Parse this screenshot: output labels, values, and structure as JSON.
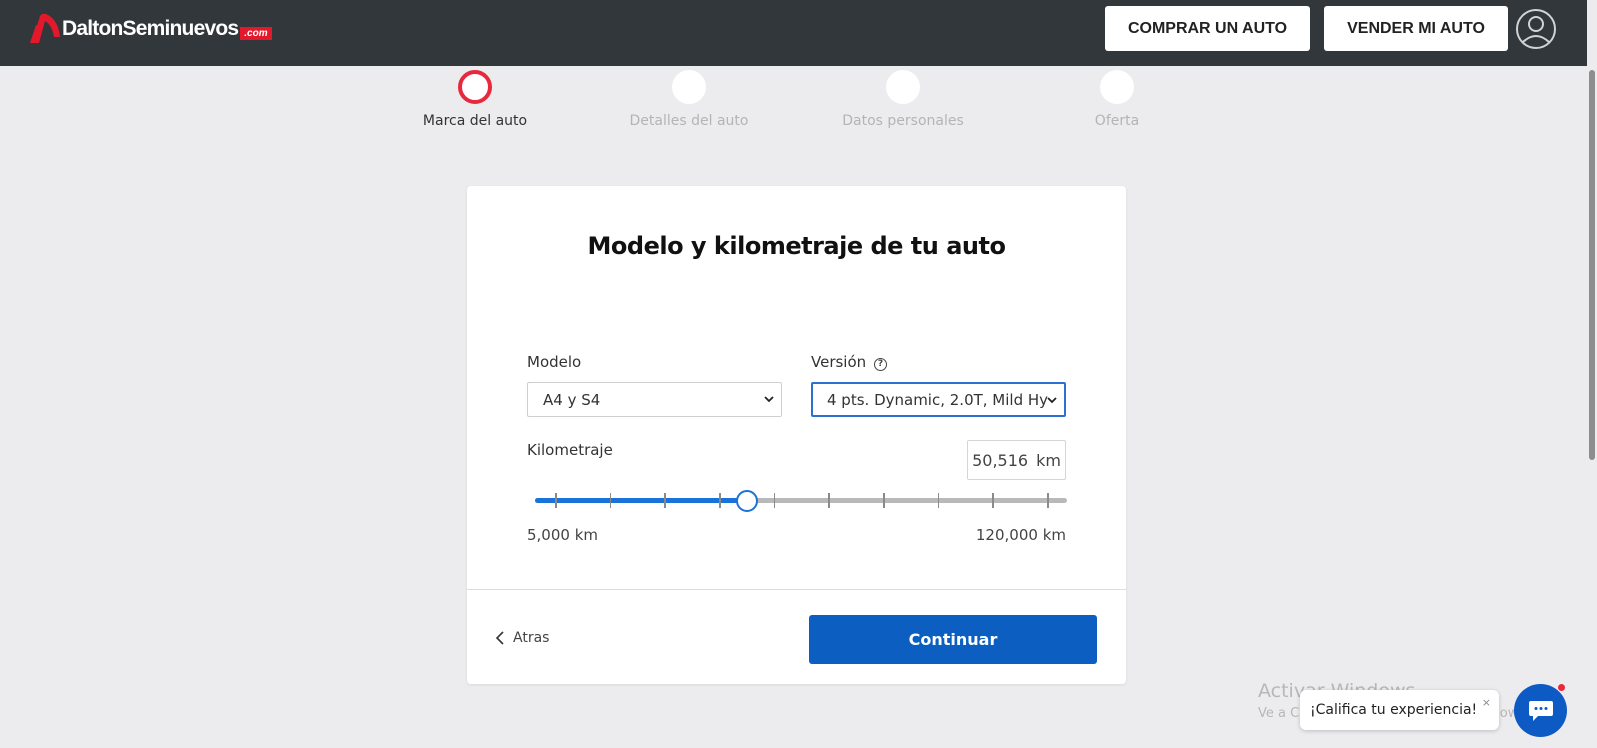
{
  "header": {
    "logo_text": "DaltonSeminuevos",
    "logo_suffix": ".com",
    "buy_label": "COMPRAR UN AUTO",
    "sell_label": "VENDER MI AUTO",
    "avatar_icon": "user-circle-icon"
  },
  "stepper": {
    "steps": [
      {
        "label": "Marca del auto",
        "active": true
      },
      {
        "label": "Detalles del auto",
        "active": false
      },
      {
        "label": "Datos personales",
        "active": false
      },
      {
        "label": "Oferta",
        "active": false
      }
    ]
  },
  "card": {
    "title": "Modelo y kilometraje de tu auto",
    "model": {
      "label": "Modelo",
      "value": "A4 y S4"
    },
    "version": {
      "label": "Versión",
      "value": "4 pts. Dynamic, 2.0T, Mild Hy",
      "help_icon": "question-circle-icon"
    },
    "mileage": {
      "label": "Kilometraje",
      "value": "50,516",
      "unit": "km",
      "min_label": "5,000 km",
      "max_label": "120,000 km",
      "min": 5000,
      "max": 120000,
      "current": 50516
    },
    "back_label": "Atras",
    "continue_label": "Continuar"
  },
  "windows_watermark": {
    "title": "Activar Windows",
    "subtitle": "Ve a Configuración para activar Windows."
  },
  "feedback": {
    "label": "¡Califica tu experiencia!",
    "close": "×"
  },
  "colors": {
    "header_bg": "#32373c",
    "brand_red": "#e8283d",
    "primary_blue": "#0c5fc0",
    "slider_blue": "#1a73d9"
  }
}
